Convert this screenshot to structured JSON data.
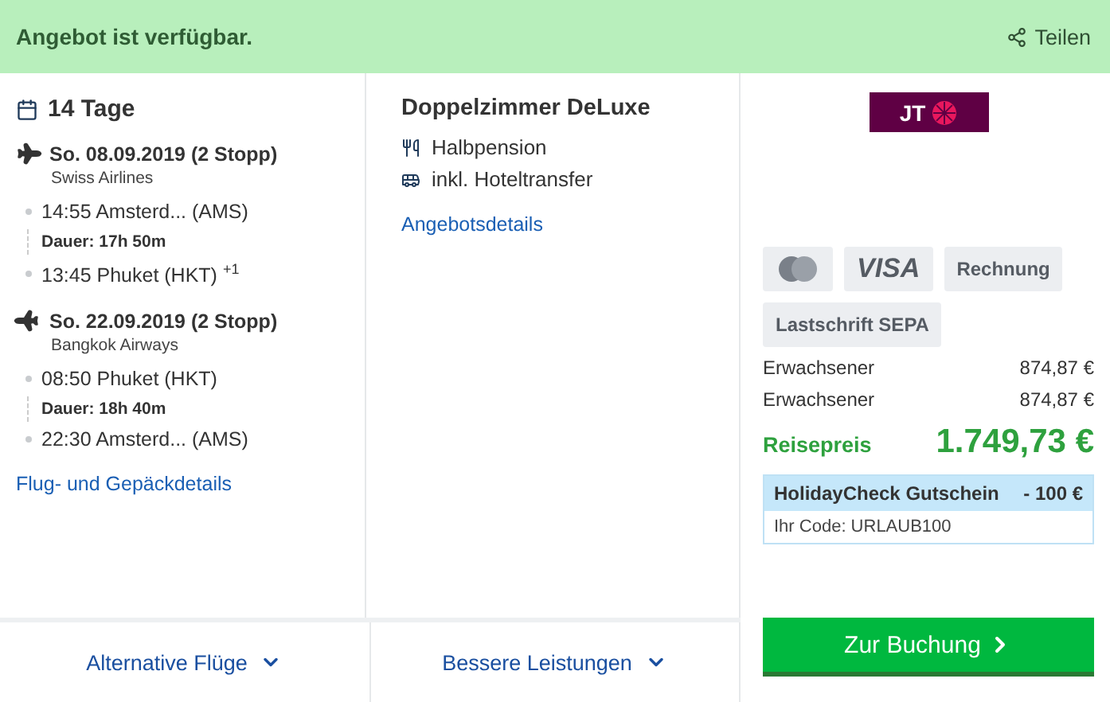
{
  "banner": {
    "message": "Angebot ist verfügbar.",
    "share": "Teilen"
  },
  "trip": {
    "duration": "14 Tage",
    "flights": [
      {
        "kind": "outbound",
        "date": "So. 08.09.2019 (2 Stopp)",
        "airline": "Swiss Airlines",
        "departure": "14:55 Amsterd... (AMS)",
        "duration": "Dauer: 17h 50m",
        "arrival": "13:45 Phuket (HKT) $^{+1}$"
      },
      {
        "kind": "return",
        "date": "So. 22.09.2019 (2 Stopp)",
        "airline": "Bangkok Airways",
        "departure": "08:50 Phuket (HKT)",
        "duration": "Dauer: 18h 40m",
        "arrival": "22:30 Amsterd... (AMS)"
      }
    ],
    "details_link": "Flug- und Gepäckdetails"
  },
  "hotel": {
    "room": "Doppelzimmer DeLuxe",
    "features": [
      {
        "kind": "meal",
        "label": "Halbpension"
      },
      {
        "kind": "bus",
        "label": "inkl. Hoteltransfer"
      }
    ],
    "details_link": "Angebotsdetails"
  },
  "offer": {
    "operator_logo": "JT",
    "payments": [
      {
        "kind": "mastercard"
      },
      {
        "kind": "visa",
        "label": "VISA"
      },
      {
        "kind": "text",
        "label": "Rechnung"
      },
      {
        "kind": "text",
        "label": "Lastschrift SEPA"
      }
    ],
    "prices": [
      {
        "label": "Erwachsener",
        "amount": "874,87 €"
      },
      {
        "label": "Erwachsener",
        "amount": "874,87 €"
      }
    ],
    "total": {
      "label": "Reisepreis",
      "amount": "1.749,73 €"
    },
    "voucher": {
      "title": "HolidayCheck Gutschein",
      "amount": "- 100 €",
      "code": "Ihr Code: URLAUB100"
    },
    "book_button": "Zur Buchung"
  },
  "footer": {
    "buttons": [
      "Alternative Flüge",
      "Bessere Leistungen"
    ]
  }
}
